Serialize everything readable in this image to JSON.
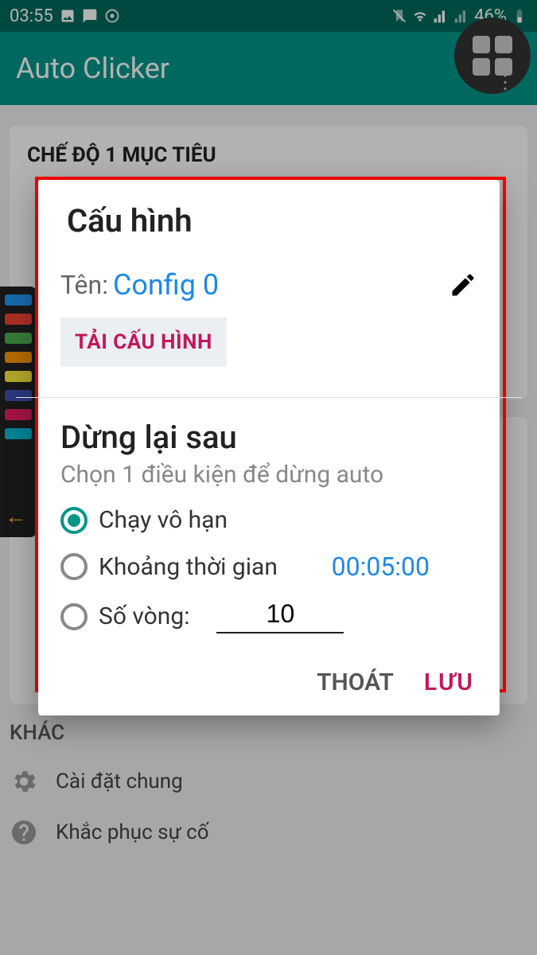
{
  "status": {
    "time": "03:55",
    "battery": "46%"
  },
  "app_bar": {
    "title": "Auto Clicker"
  },
  "bg": {
    "card1_title": "CHẾ ĐỘ 1 MỤC TIÊU",
    "section_other": "KHÁC",
    "item_general": "Cài đặt chung",
    "item_trouble": "Khắc phục sự cố"
  },
  "dialog": {
    "title": "Cấu hình",
    "name_label": "Tên:",
    "name_value": "Config 0",
    "load_btn": "TẢI CẤU HÌNH",
    "stop_title": "Dừng lại sau",
    "stop_sub": "Chọn 1 điều kiện để dừng auto",
    "opt_infinite": "Chạy vô hạn",
    "opt_duration": "Khoảng thời gian",
    "duration_value": "00:05:00",
    "opt_cycles": "Số vòng:",
    "cycles_value": "10",
    "btn_cancel": "THOÁT",
    "btn_save": "LƯU"
  }
}
